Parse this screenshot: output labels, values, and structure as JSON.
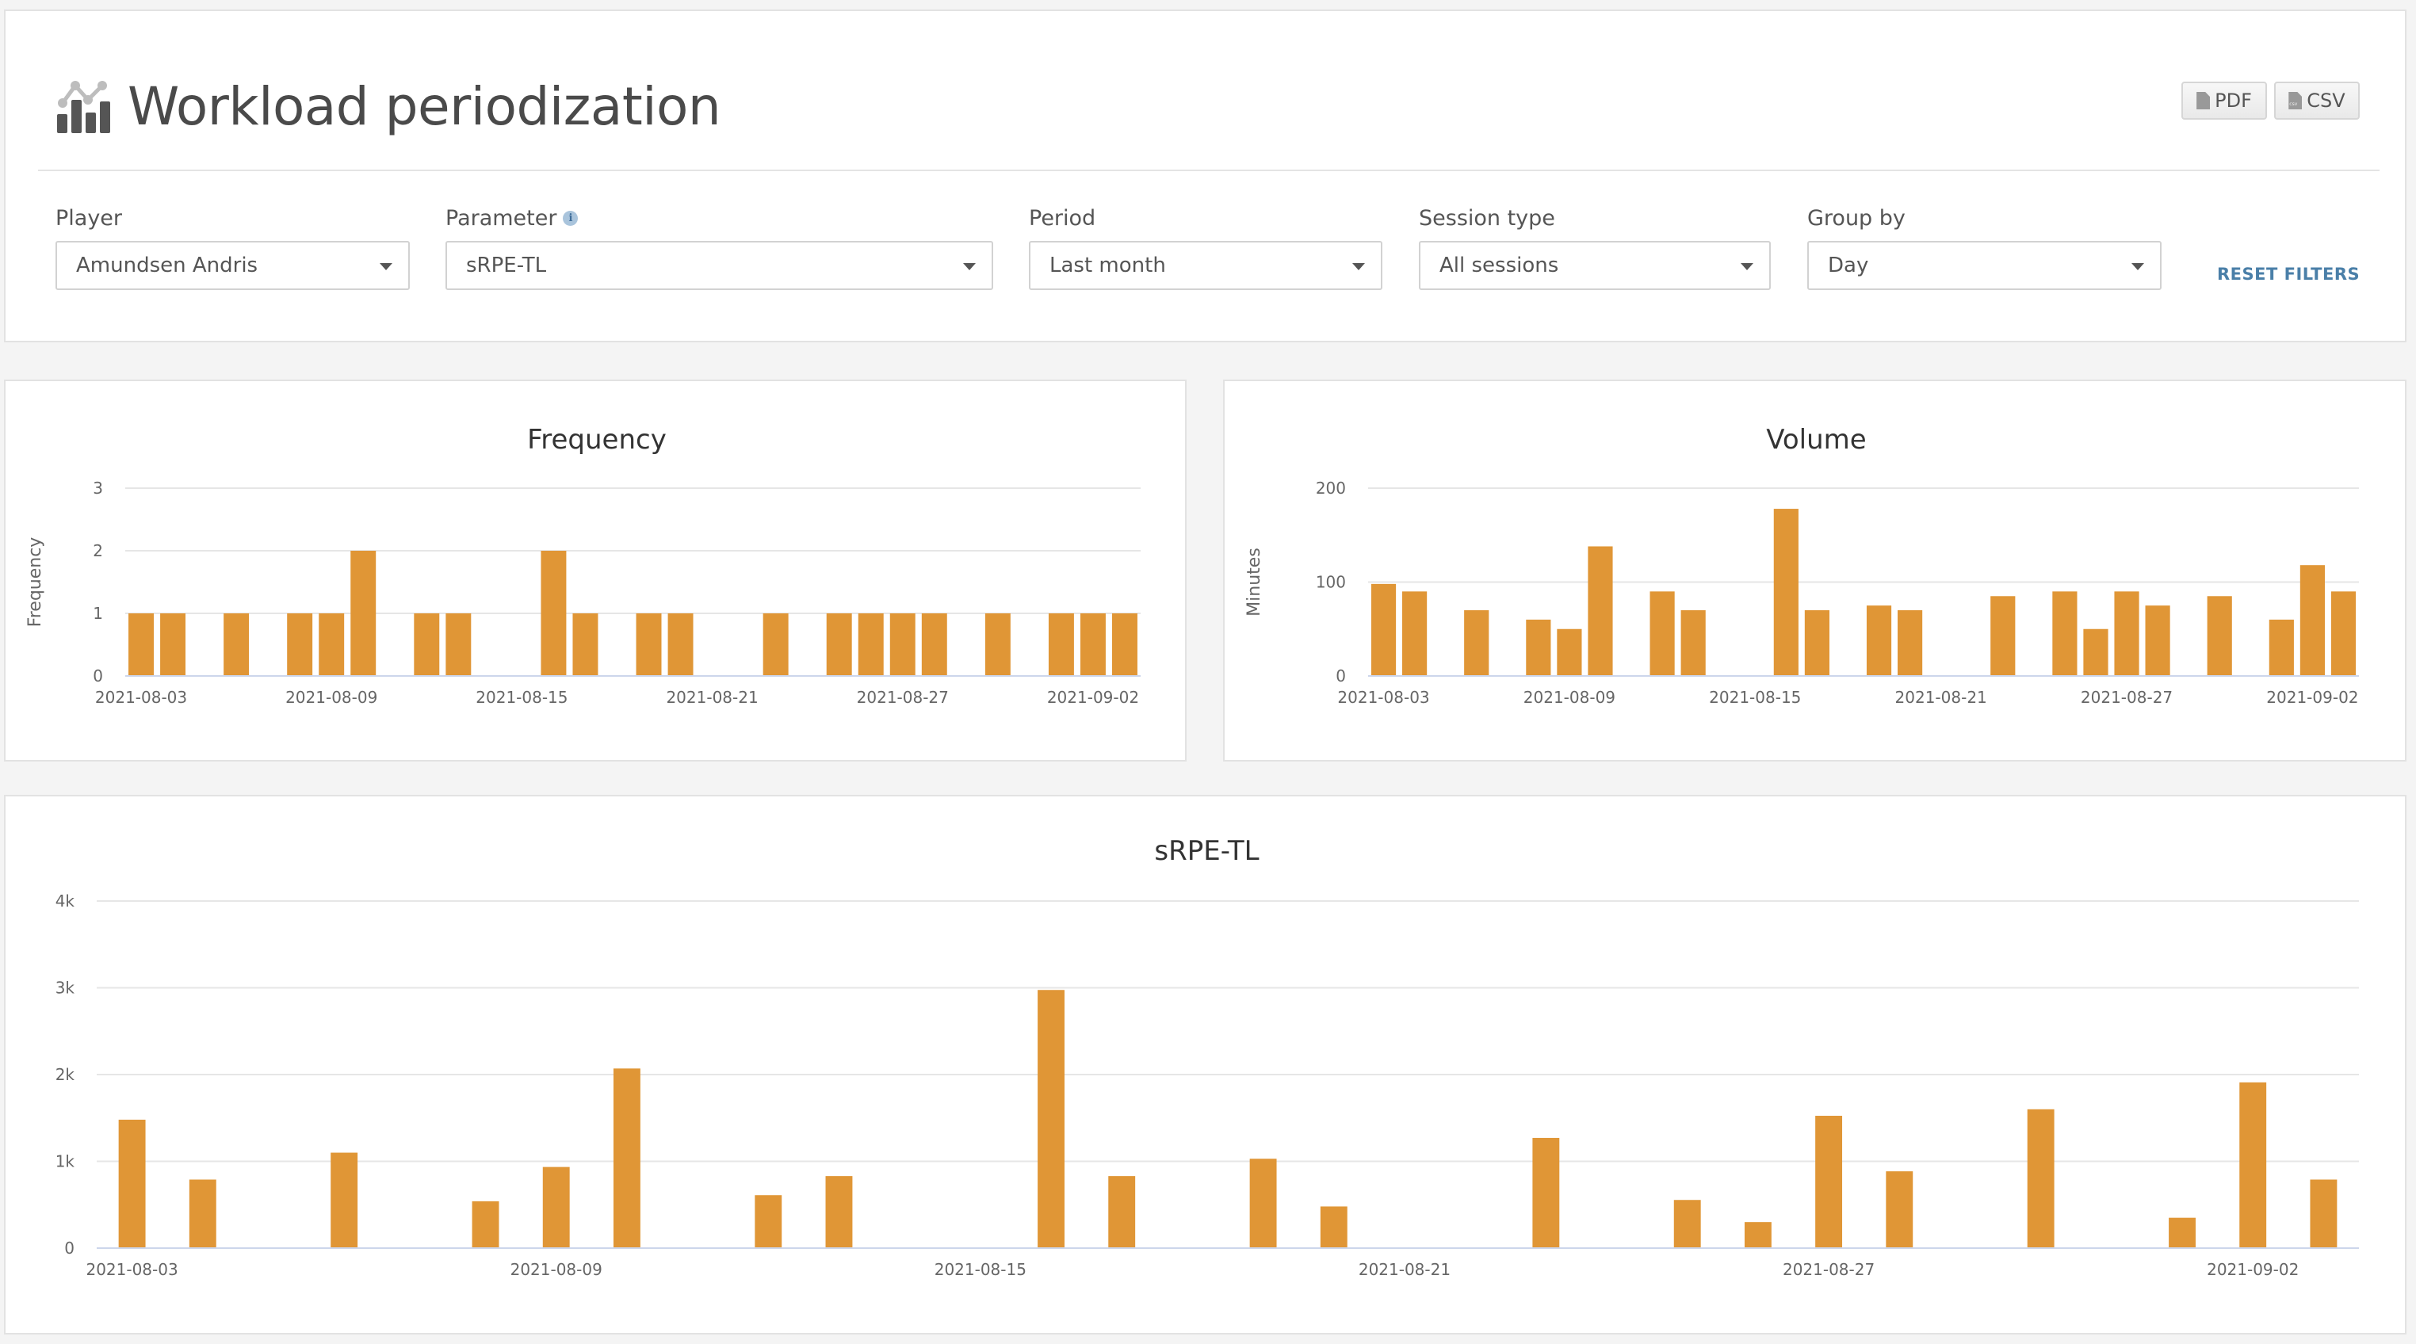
{
  "header": {
    "title": "Workload periodization",
    "title_icon": "chart-line-bar-icon",
    "export_buttons": [
      {
        "label": "PDF",
        "icon": "file-pdf-icon"
      },
      {
        "label": "CSV",
        "icon": "file-csv-icon"
      }
    ]
  },
  "filters": {
    "player": {
      "label": "Player",
      "value": "Amundsen Andris"
    },
    "parameter": {
      "label": "Parameter",
      "value": "sRPE-TL",
      "info_icon": "info-icon"
    },
    "period": {
      "label": "Period",
      "value": "Last month"
    },
    "session_type": {
      "label": "Session type",
      "value": "All sessions"
    },
    "group_by": {
      "label": "Group by",
      "value": "Day"
    },
    "reset_label": "RESET FILTERS"
  },
  "colors": {
    "bar": "#e09636",
    "link": "#4a7fa8",
    "background": "#f4f4f4"
  },
  "chart_data": [
    {
      "id": "frequency",
      "type": "bar",
      "title": "Frequency",
      "xlabel": "",
      "ylabel": "Frequency",
      "ylim": [
        0,
        3
      ],
      "yticks": [
        0,
        1,
        2,
        3
      ],
      "ytick_labels": [
        "0",
        "1",
        "2",
        "3"
      ],
      "x_domain": [
        "2021-08-03",
        "2021-09-03"
      ],
      "xtick_labels": [
        "2021-08-03",
        "2021-08-09",
        "2021-08-15",
        "2021-08-21",
        "2021-08-27",
        "2021-09-02"
      ],
      "grid": true,
      "x": [
        "2021-08-03",
        "2021-08-04",
        "2021-08-06",
        "2021-08-08",
        "2021-08-09",
        "2021-08-10",
        "2021-08-12",
        "2021-08-13",
        "2021-08-16",
        "2021-08-17",
        "2021-08-19",
        "2021-08-20",
        "2021-08-23",
        "2021-08-25",
        "2021-08-26",
        "2021-08-27",
        "2021-08-28",
        "2021-08-30",
        "2021-09-01",
        "2021-09-02",
        "2021-09-03"
      ],
      "values": [
        1,
        1,
        1,
        1,
        1,
        2,
        1,
        1,
        2,
        1,
        1,
        1,
        1,
        1,
        1,
        1,
        1,
        1,
        1,
        1,
        1
      ]
    },
    {
      "id": "volume",
      "type": "bar",
      "title": "Volume",
      "xlabel": "",
      "ylabel": "Minutes",
      "ylim": [
        0,
        200
      ],
      "yticks": [
        0,
        100,
        200
      ],
      "ytick_labels": [
        "0",
        "100",
        "200"
      ],
      "x_domain": [
        "2021-08-03",
        "2021-09-03"
      ],
      "xtick_labels": [
        "2021-08-03",
        "2021-08-09",
        "2021-08-15",
        "2021-08-21",
        "2021-08-27",
        "2021-09-02"
      ],
      "grid": true,
      "x": [
        "2021-08-03",
        "2021-08-04",
        "2021-08-06",
        "2021-08-08",
        "2021-08-09",
        "2021-08-10",
        "2021-08-12",
        "2021-08-13",
        "2021-08-16",
        "2021-08-17",
        "2021-08-19",
        "2021-08-20",
        "2021-08-23",
        "2021-08-25",
        "2021-08-26",
        "2021-08-27",
        "2021-08-28",
        "2021-08-30",
        "2021-09-01",
        "2021-09-02",
        "2021-09-03"
      ],
      "values": [
        98,
        90,
        70,
        60,
        50,
        138,
        90,
        70,
        178,
        70,
        75,
        70,
        85,
        90,
        50,
        90,
        75,
        85,
        60,
        118,
        90
      ]
    },
    {
      "id": "srpe",
      "type": "bar",
      "title": "sRPE-TL",
      "xlabel": "",
      "ylabel": "",
      "ylim": [
        0,
        4000
      ],
      "yticks": [
        0,
        1000,
        2000,
        3000,
        4000
      ],
      "ytick_labels": [
        "0",
        "1k",
        "2k",
        "3k",
        "4k"
      ],
      "x_domain": [
        "2021-08-03",
        "2021-09-03"
      ],
      "xtick_labels": [
        "2021-08-03",
        "2021-08-09",
        "2021-08-15",
        "2021-08-21",
        "2021-08-27",
        "2021-09-02"
      ],
      "grid": true,
      "x": [
        "2021-08-03",
        "2021-08-04",
        "2021-08-06",
        "2021-08-08",
        "2021-08-09",
        "2021-08-10",
        "2021-08-12",
        "2021-08-13",
        "2021-08-16",
        "2021-08-17",
        "2021-08-19",
        "2021-08-20",
        "2021-08-23",
        "2021-08-25",
        "2021-08-26",
        "2021-08-27",
        "2021-08-28",
        "2021-08-30",
        "2021-09-01",
        "2021-09-02",
        "2021-09-03"
      ],
      "values": [
        1480,
        790,
        1100,
        540,
        935,
        2070,
        610,
        830,
        2975,
        830,
        1030,
        480,
        1270,
        555,
        300,
        1525,
        885,
        1600,
        350,
        1910,
        790
      ]
    }
  ]
}
